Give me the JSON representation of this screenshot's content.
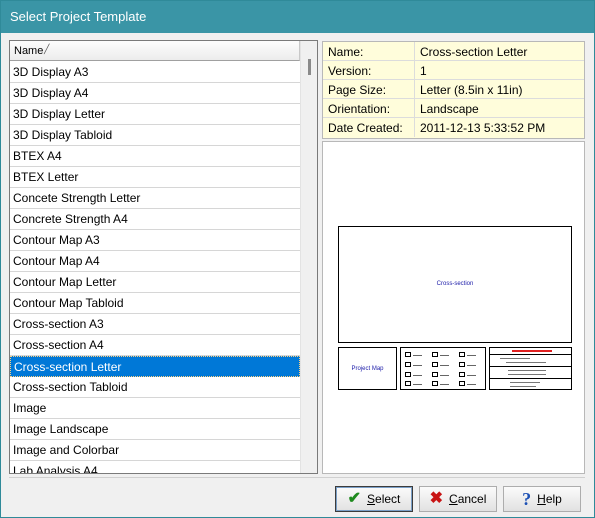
{
  "window": {
    "title": "Select Project Template"
  },
  "list": {
    "column_header": "Name",
    "items": [
      "3D Display A3",
      "3D Display A4",
      "3D Display Letter",
      "3D Display Tabloid",
      "BTEX A4",
      "BTEX Letter",
      "Concete Strength Letter",
      "Concrete Strength A4",
      "Contour Map A3",
      "Contour Map A4",
      "Contour Map Letter",
      "Contour Map Tabloid",
      "Cross-section A3",
      "Cross-section A4",
      "Cross-section Letter",
      "Cross-section Tabloid",
      "Image",
      "Image Landscape",
      "Image and Colorbar",
      "Lab Analysis A4"
    ],
    "selected_index": 14
  },
  "info": {
    "rows": [
      {
        "key": "Name:",
        "value": "Cross-section Letter"
      },
      {
        "key": "Version:",
        "value": "1"
      },
      {
        "key": "Page Size:",
        "value": "Letter (8.5in x 11in)"
      },
      {
        "key": "Orientation:",
        "value": "Landscape"
      },
      {
        "key": "Date Created:",
        "value": "2011-12-13 5:33:52 PM"
      }
    ]
  },
  "preview": {
    "main_caption": "Cross-section",
    "map_caption": "Project Map"
  },
  "buttons": {
    "select": {
      "label_first": "S",
      "label_rest": "elect",
      "icon": "check-icon"
    },
    "cancel": {
      "label_first": "C",
      "label_rest": "ancel",
      "icon": "cross-icon"
    },
    "help": {
      "label_first": "H",
      "label_rest": "elp",
      "icon": "question-icon"
    }
  },
  "colors": {
    "titlebar": "#3a95a6",
    "selection": "#0078d7",
    "info_background": "#fffddb"
  }
}
